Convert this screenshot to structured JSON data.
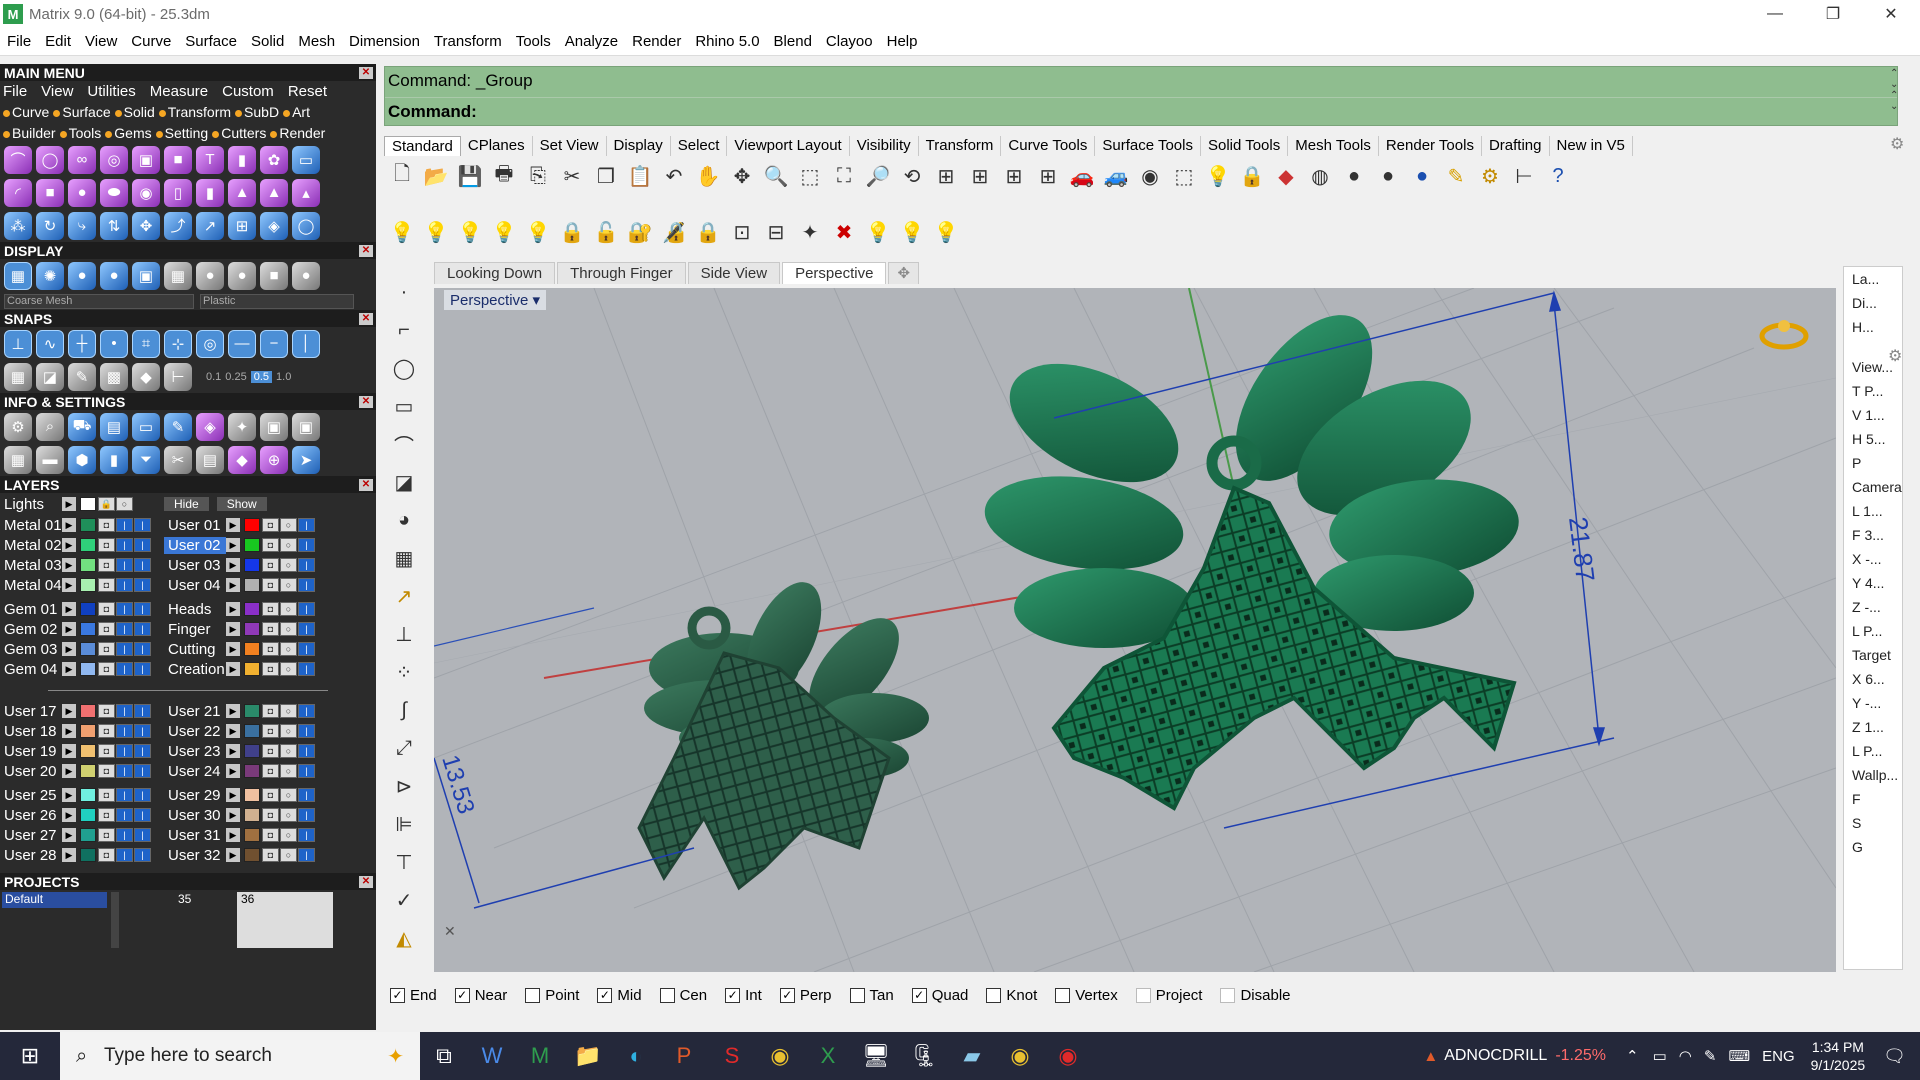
{
  "window": {
    "title": "Matrix 9.0 (64-bit) - 25.3dm",
    "controls": [
      "minimize-icon",
      "restore-icon",
      "close-icon"
    ]
  },
  "menubar": [
    "File",
    "Edit",
    "View",
    "Curve",
    "Surface",
    "Solid",
    "Mesh",
    "Dimension",
    "Transform",
    "Tools",
    "Analyze",
    "Render",
    "Rhino 5.0",
    "Blend",
    "Clayoo",
    "Help"
  ],
  "left_panel": {
    "main_menu": {
      "title": "MAIN MENU",
      "sub": [
        "File",
        "View",
        "Utilities",
        "Measure",
        "Custom",
        "Reset"
      ],
      "cats1": [
        "Curve",
        "Surface",
        "Solid",
        "Transform",
        "SubD",
        "Art"
      ],
      "cats2": [
        "Builder",
        "Tools",
        "Gems",
        "Setting",
        "Cutters",
        "Render"
      ]
    },
    "display": {
      "title": "DISPLAY",
      "mesh": "Coarse Mesh",
      "material": "Plastic"
    },
    "snaps": {
      "title": "SNAPS",
      "values": [
        "0.1",
        "0.25",
        "0.5",
        "1.0"
      ]
    },
    "info": {
      "title": "INFO & SETTINGS"
    },
    "layers": {
      "title": "LAYERS",
      "lights": "Lights",
      "hide": "Hide",
      "show": "Show",
      "groupA": [
        {
          "left": "Metal 01",
          "lc": "#1f8f5a",
          "right": "User 01",
          "rc": "#ff0000"
        },
        {
          "left": "Metal 02",
          "lc": "#2fd07a",
          "right": "User 02",
          "rc": "#18c820",
          "sel": true
        },
        {
          "left": "Metal 03",
          "lc": "#72e080",
          "right": "User 03",
          "rc": "#1537e8"
        },
        {
          "left": "Metal 04",
          "lc": "#a8f0b0",
          "right": "User 04",
          "rc": "#b0b0b0"
        }
      ],
      "groupB": [
        {
          "left": "Gem 01",
          "lc": "#1040c0",
          "right": "Heads",
          "rc": "#8a2fc8"
        },
        {
          "left": "Gem 02",
          "lc": "#3a78e0",
          "right": "Finger",
          "rc": "#8f39b8"
        },
        {
          "left": "Gem 03",
          "lc": "#5a8cd8",
          "right": "Cutting",
          "rc": "#f08020"
        },
        {
          "left": "Gem 04",
          "lc": "#90b8f0",
          "right": "Creation",
          "rc": "#f0b030"
        }
      ],
      "groupC": [
        {
          "left": "User 17",
          "lc": "#f07070",
          "right": "User 21",
          "rc": "#2a8a6a"
        },
        {
          "left": "User 18",
          "lc": "#f0a070",
          "right": "User 22",
          "rc": "#3a70a0"
        },
        {
          "left": "User 19",
          "lc": "#f0c070",
          "right": "User 23",
          "rc": "#40408a"
        },
        {
          "left": "User 20",
          "lc": "#d0d070",
          "right": "User 24",
          "rc": "#7a3a7a"
        }
      ],
      "groupD": [
        {
          "left": "User 25",
          "lc": "#70f0e0",
          "right": "User 29",
          "rc": "#f0c0a0"
        },
        {
          "left": "User 26",
          "lc": "#20d0c0",
          "right": "User 30",
          "rc": "#d0b090"
        },
        {
          "left": "User 27",
          "lc": "#20a090",
          "right": "User 31",
          "rc": "#a07040"
        },
        {
          "left": "User 28",
          "lc": "#107060",
          "right": "User 32",
          "rc": "#705030"
        }
      ]
    },
    "projects": {
      "title": "PROJECTS",
      "default": "Default",
      "n1": "35",
      "n2": "36"
    }
  },
  "command": {
    "line1": "Command: _Group",
    "line2": "Command:"
  },
  "toolbar_tabs": [
    "Standard",
    "CPlanes",
    "Set View",
    "Display",
    "Select",
    "Viewport Layout",
    "Visibility",
    "Transform",
    "Curve Tools",
    "Surface Tools",
    "Solid Tools",
    "Mesh Tools",
    "Render Tools",
    "Drafting",
    "New in V5"
  ],
  "viewport_tabs": [
    "Looking Down",
    "Through Finger",
    "Side View",
    "Perspective"
  ],
  "viewport": {
    "label": "Perspective",
    "dim1": "21.87",
    "dim2": "13.53"
  },
  "right_panel": [
    "La...",
    "Di...",
    "H...",
    "",
    "View...",
    "T  P...",
    "V  1...",
    "H  5...",
    "P",
    "Camera",
    "L  1...",
    "F  3...",
    "X  -...",
    "Y  4...",
    "Z  -...",
    "L  P...",
    "Target",
    "X  6...",
    "Y  -...",
    "Z  1...",
    "L  P...",
    "Wallp...",
    "F",
    "S",
    "G"
  ],
  "snaps": [
    {
      "label": "End",
      "checked": true
    },
    {
      "label": "Near",
      "checked": true
    },
    {
      "label": "Point",
      "checked": false
    },
    {
      "label": "Mid",
      "checked": true
    },
    {
      "label": "Cen",
      "checked": false
    },
    {
      "label": "Int",
      "checked": true
    },
    {
      "label": "Perp",
      "checked": true
    },
    {
      "label": "Tan",
      "checked": false
    },
    {
      "label": "Quad",
      "checked": true
    },
    {
      "label": "Knot",
      "checked": false
    },
    {
      "label": "Vertex",
      "checked": false
    },
    {
      "label": "Project",
      "checked": false,
      "disabled": true
    },
    {
      "label": "Disable",
      "checked": false,
      "disabled": true
    }
  ],
  "taskbar": {
    "search": "Type here to search",
    "stock_name": "ADNOCDRILL",
    "stock_change": "-1.25%",
    "lang": "ENG",
    "time": "1:34 PM",
    "date": "9/1/2025"
  },
  "colors": {
    "model": "#1f6b4c",
    "command_bg": "#8fbd8f",
    "viewport_bg": "#b1b4b9"
  }
}
